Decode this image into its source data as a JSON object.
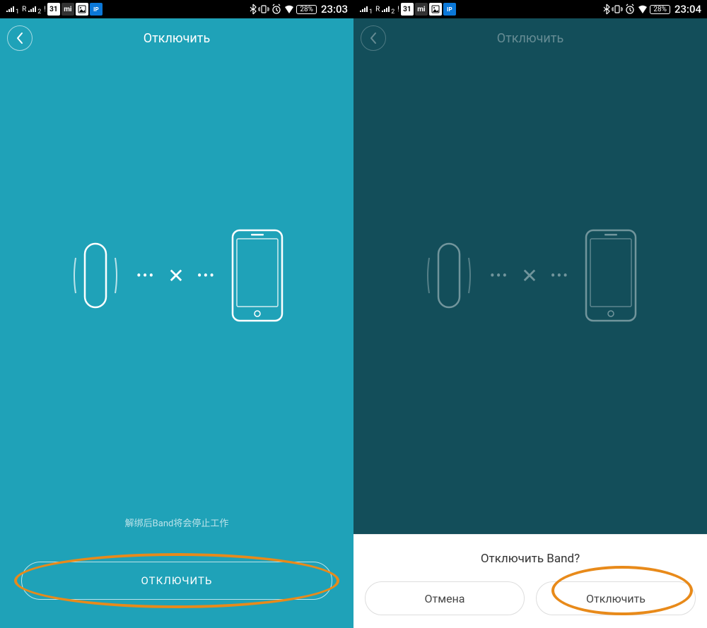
{
  "left": {
    "status": {
      "battery": "28%",
      "time": "23:03",
      "cal_day": "31"
    },
    "header": {
      "title": "Отключить"
    },
    "hint": "解绑后Band将会停止工作",
    "mainButtonLabel": "ОТКЛЮЧИТЬ"
  },
  "right": {
    "status": {
      "battery": "28%",
      "time": "23:04",
      "cal_day": "31"
    },
    "header": {
      "title": "Отключить"
    },
    "sheet": {
      "title": "Отключить Band?",
      "cancel": "Отмена",
      "confirm": "Отключить"
    }
  }
}
